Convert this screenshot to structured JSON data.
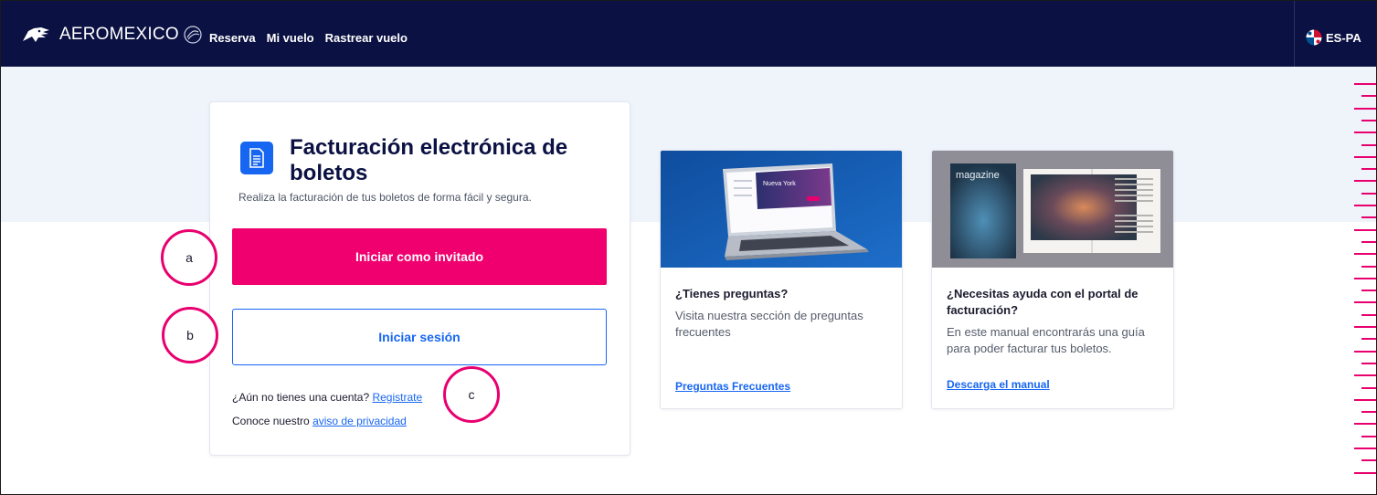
{
  "header": {
    "brand": "AEROMEXICO",
    "nav": [
      "Reserva",
      "Mi vuelo",
      "Rastrear vuelo"
    ],
    "language": "ES-PA"
  },
  "main_card": {
    "title": "Facturación electrónica de boletos",
    "subtitle": "Realiza la facturación de tus boletos de forma fácil y segura.",
    "guest_button": "Iniciar como invitado",
    "login_button": "Iniciar sesión",
    "register_prompt": "¿Aún no tienes una cuenta?",
    "register_link": "Registrate",
    "privacy_prompt": "Conoce nuestro",
    "privacy_link": "aviso de privacidad"
  },
  "faq_card": {
    "image_text": "Nueva York",
    "title": "¿Tienes preguntas?",
    "text": "Visita nuestra sección de preguntas frecuentes",
    "link": "Preguntas Frecuentes"
  },
  "manual_card": {
    "image_text": "magazine",
    "title": "¿Necesitas ayuda con el portal de facturación?",
    "text": "En este manual encontrarás una guía para poder facturar tus boletos.",
    "link": "Descarga el manual"
  },
  "annotations": [
    "a",
    "b",
    "c"
  ],
  "colors": {
    "navy": "#0b1142",
    "pink": "#f0006e",
    "blue": "#1766f2",
    "band": "#eff3fa"
  }
}
